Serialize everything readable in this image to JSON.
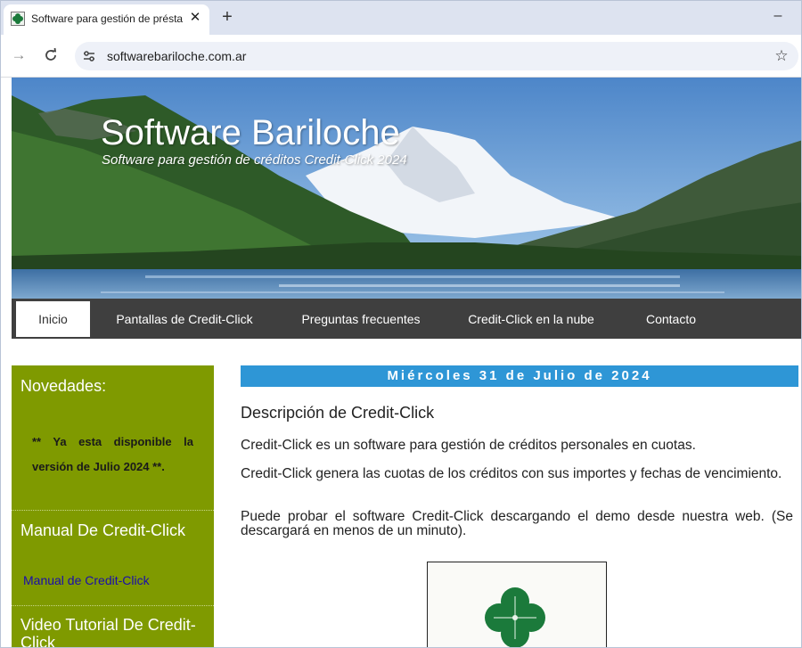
{
  "browser": {
    "tab_title": "Software para gestión de présta",
    "tab_close": "✕",
    "new_tab": "+",
    "minimize": "–",
    "forward": "→",
    "url": "softwarebariloche.com.ar",
    "bookmark": "☆"
  },
  "icons": {
    "favicon": "clover-icon",
    "site_info": "tune-icon",
    "reload": "reload-icon",
    "bookmark": "star-icon"
  },
  "header": {
    "title": "Software Bariloche",
    "subtitle": "Software para gestión de créditos Credit-Click 2024"
  },
  "nav": {
    "items": [
      {
        "label": "Inicio",
        "active": true
      },
      {
        "label": "Pantallas de Credit-Click",
        "active": false
      },
      {
        "label": "Preguntas frecuentes",
        "active": false
      },
      {
        "label": "Credit-Click en la nube",
        "active": false
      },
      {
        "label": "Contacto",
        "active": false
      }
    ]
  },
  "sidebar": {
    "novedades_title": "Novedades:",
    "novedades_text": "** Ya esta disponible la versión de Julio 2024 **.",
    "manual_title": "Manual De Credit-Click",
    "manual_link": "Manual de Credit-Click",
    "video_title": "Video Tutorial De Credit-Click"
  },
  "main": {
    "date": "Miércoles 31 de Julio de 2024",
    "post_title": "Descripción de Credit-Click",
    "paragraphs": [
      "Credit-Click es un software para gestión de créditos personales en cuotas.",
      "Credit-Click genera las cuotas de los créditos con sus importes y fechas de vencimiento.",
      "Puede probar el software Credit-Click descargando el demo desde nuestra web. (Se descargará en menos de un minuto)."
    ]
  },
  "colors": {
    "nav_background": "#3f3f3f",
    "sidebar_background": "#7f9a00",
    "date_bar": "#2e96d6",
    "link": "#1a0dab",
    "clover": "#1b7a3b"
  }
}
